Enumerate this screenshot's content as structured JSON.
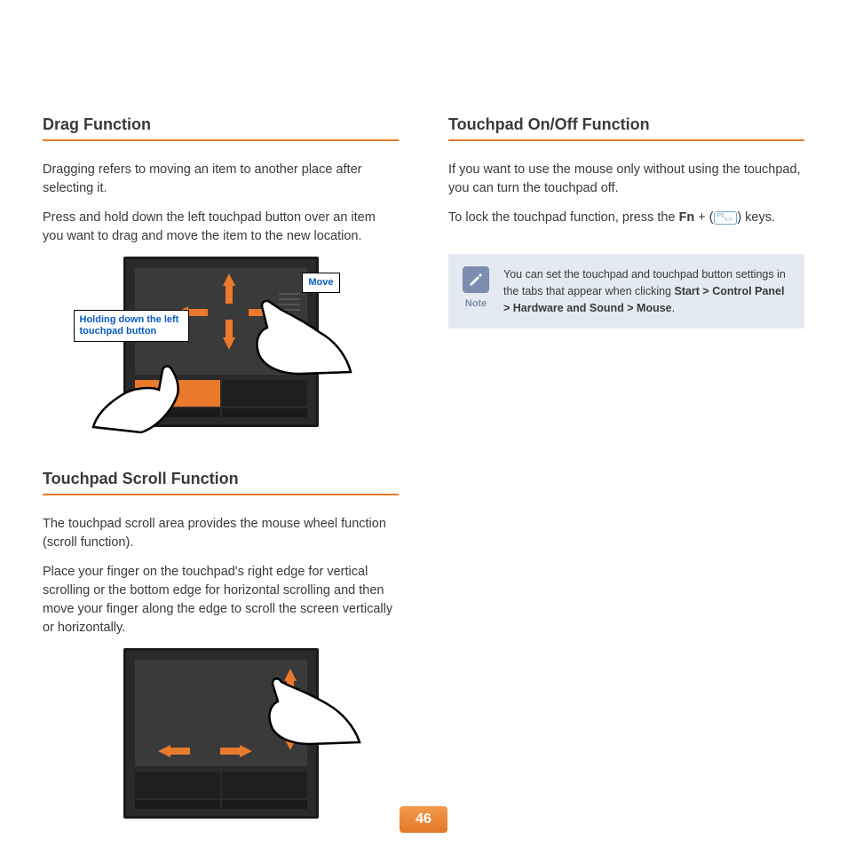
{
  "page_number": "46",
  "left": {
    "section1": {
      "heading": "Drag Function",
      "p1": "Dragging refers to moving an item to another place after selecting it.",
      "p2": "Press and hold down the left touchpad button over an item you want to drag and move the item to the new location.",
      "fig": {
        "callout_move": "Move",
        "callout_hold": "Holding down the left touchpad button"
      }
    },
    "section2": {
      "heading": "Touchpad Scroll Function",
      "p1": "The touchpad scroll area provides the mouse wheel function (scroll function).",
      "p2": "Place your finger on the touchpad's right edge for vertical scrolling or the bottom edge for horizontal scrolling and then move your finger along the edge to scroll the screen vertically or horizontally."
    }
  },
  "right": {
    "section1": {
      "heading": "Touchpad On/Off Function",
      "p1": "If you want to use the mouse only without using the touchpad, you can turn the touchpad off.",
      "p2_pre": "To lock the touchpad function, press the ",
      "p2_fn": "Fn",
      "p2_plus": " + (",
      "key_sup": "F5",
      "p2_post": ") keys."
    },
    "note": {
      "label": "Note",
      "text_pre": "You can set the touchpad and touchpad button settings in the tabs that appear when clicking ",
      "path": "Start > Control Panel > Hardware and Sound > Mouse",
      "text_post": "."
    }
  }
}
